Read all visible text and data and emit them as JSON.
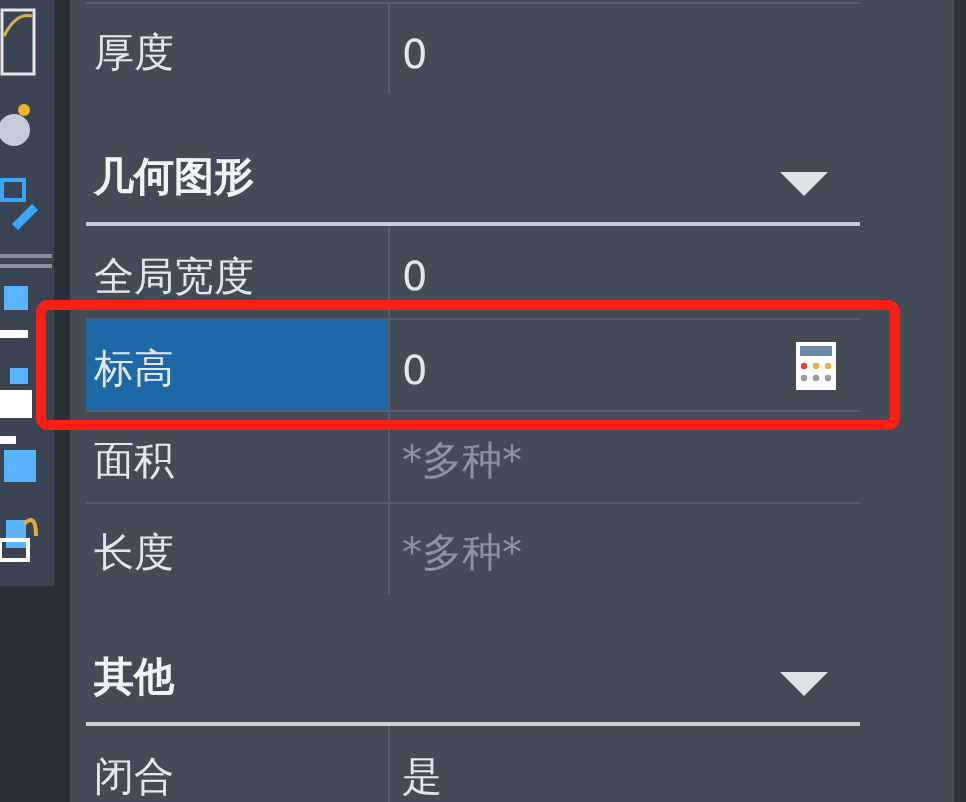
{
  "top_rows": [
    {
      "label": "厚度",
      "value": "0",
      "selected": false,
      "disabled": false
    }
  ],
  "sections": [
    {
      "title": "几何图形",
      "expanded": true,
      "rows": [
        {
          "label": "全局宽度",
          "value": "0",
          "selected": false,
          "disabled": false
        },
        {
          "label": "标高",
          "value": "0",
          "selected": true,
          "disabled": false
        },
        {
          "label": "面积",
          "value": "*多种*",
          "selected": false,
          "disabled": true
        },
        {
          "label": "长度",
          "value": "*多种*",
          "selected": false,
          "disabled": true
        }
      ]
    },
    {
      "title": "其他",
      "expanded": true,
      "rows": [
        {
          "label": "闭合",
          "value": "是",
          "selected": false,
          "disabled": false
        }
      ]
    }
  ]
}
